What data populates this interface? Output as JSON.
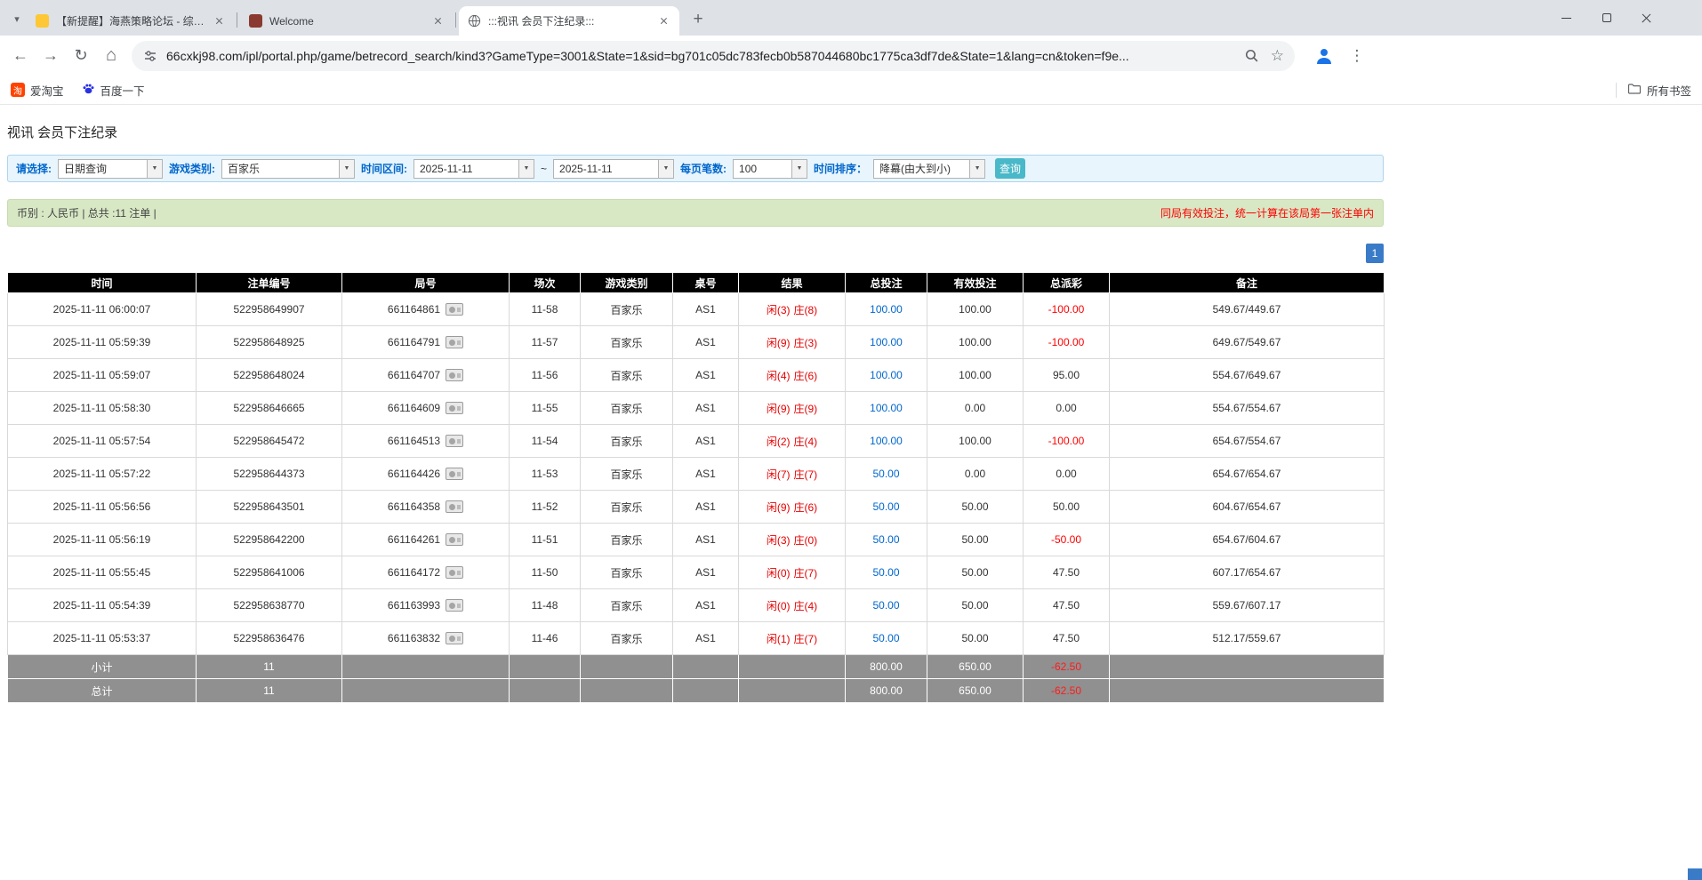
{
  "browser": {
    "tabs": [
      {
        "title": "【新提醒】海燕策略论坛 - 综合..."
      },
      {
        "title": "Welcome"
      },
      {
        "title": ":::视讯 会员下注纪录:::"
      }
    ],
    "url": "66cxkj98.com/ipl/portal.php/game/betrecord_search/kind3?GameType=3001&State=1&sid=bg701c05dc783fecb0b587044680bc1775ca3df7de&State=1&lang=cn&token=f9e...",
    "bookmarks": {
      "taobao": "爱淘宝",
      "taobao_icon_char": "淘",
      "baidu": "百度一下",
      "all_bookmarks": "所有书签"
    }
  },
  "page": {
    "title": "视讯 会员下注纪录",
    "filter": {
      "select_label": "请选择:",
      "select_value": "日期查询",
      "game_label": "游戏类别:",
      "game_value": "百家乐",
      "range_label": "时间区间:",
      "date_from": "2025-11-11",
      "tilde": "~",
      "date_to": "2025-11-11",
      "per_page_label": "每页笔数:",
      "per_page_value": "100",
      "sort_label": "时间排序：",
      "sort_value": "降幕(由大到小)",
      "search_button": "查询"
    },
    "summary_bar": {
      "left": "币别 : 人民币 | 总共 :11 注单 |",
      "right": "同局有效投注，统一计算在该局第一张注单内"
    },
    "pagination": {
      "page": "1"
    },
    "table": {
      "headers": [
        "时间",
        "注单编号",
        "局号",
        "场次",
        "游戏类别",
        "桌号",
        "结果",
        "总投注",
        "有效投注",
        "总派彩",
        "备注"
      ],
      "rows": [
        {
          "time": "2025-11-11 06:00:07",
          "bet_no": "522958649907",
          "round_no": "661164861",
          "session": "11-58",
          "game": "百家乐",
          "table_no": "AS1",
          "result_player": "闲(3)",
          "result_banker": "庄(8)",
          "total_bet": "100.00",
          "valid_bet": "100.00",
          "payout": "-100.00",
          "note": "549.67/449.67"
        },
        {
          "time": "2025-11-11 05:59:39",
          "bet_no": "522958648925",
          "round_no": "661164791",
          "session": "11-57",
          "game": "百家乐",
          "table_no": "AS1",
          "result_player": "闲(9)",
          "result_banker": "庄(3)",
          "total_bet": "100.00",
          "valid_bet": "100.00",
          "payout": "-100.00",
          "note": "649.67/549.67"
        },
        {
          "time": "2025-11-11 05:59:07",
          "bet_no": "522958648024",
          "round_no": "661164707",
          "session": "11-56",
          "game": "百家乐",
          "table_no": "AS1",
          "result_player": "闲(4)",
          "result_banker": "庄(6)",
          "total_bet": "100.00",
          "valid_bet": "100.00",
          "payout": "95.00",
          "note": "554.67/649.67"
        },
        {
          "time": "2025-11-11 05:58:30",
          "bet_no": "522958646665",
          "round_no": "661164609",
          "session": "11-55",
          "game": "百家乐",
          "table_no": "AS1",
          "result_player": "闲(9)",
          "result_banker": "庄(9)",
          "total_bet": "100.00",
          "valid_bet": "0.00",
          "payout": "0.00",
          "note": "554.67/554.67"
        },
        {
          "time": "2025-11-11 05:57:54",
          "bet_no": "522958645472",
          "round_no": "661164513",
          "session": "11-54",
          "game": "百家乐",
          "table_no": "AS1",
          "result_player": "闲(2)",
          "result_banker": "庄(4)",
          "total_bet": "100.00",
          "valid_bet": "100.00",
          "payout": "-100.00",
          "note": "654.67/554.67"
        },
        {
          "time": "2025-11-11 05:57:22",
          "bet_no": "522958644373",
          "round_no": "661164426",
          "session": "11-53",
          "game": "百家乐",
          "table_no": "AS1",
          "result_player": "闲(7)",
          "result_banker": "庄(7)",
          "total_bet": "50.00",
          "valid_bet": "0.00",
          "payout": "0.00",
          "note": "654.67/654.67"
        },
        {
          "time": "2025-11-11 05:56:56",
          "bet_no": "522958643501",
          "round_no": "661164358",
          "session": "11-52",
          "game": "百家乐",
          "table_no": "AS1",
          "result_player": "闲(9)",
          "result_banker": "庄(6)",
          "total_bet": "50.00",
          "valid_bet": "50.00",
          "payout": "50.00",
          "note": "604.67/654.67"
        },
        {
          "time": "2025-11-11 05:56:19",
          "bet_no": "522958642200",
          "round_no": "661164261",
          "session": "11-51",
          "game": "百家乐",
          "table_no": "AS1",
          "result_player": "闲(3)",
          "result_banker": "庄(0)",
          "total_bet": "50.00",
          "valid_bet": "50.00",
          "payout": "-50.00",
          "note": "654.67/604.67"
        },
        {
          "time": "2025-11-11 05:55:45",
          "bet_no": "522958641006",
          "round_no": "661164172",
          "session": "11-50",
          "game": "百家乐",
          "table_no": "AS1",
          "result_player": "闲(0)",
          "result_banker": "庄(7)",
          "total_bet": "50.00",
          "valid_bet": "50.00",
          "payout": "47.50",
          "note": "607.17/654.67"
        },
        {
          "time": "2025-11-11 05:54:39",
          "bet_no": "522958638770",
          "round_no": "661163993",
          "session": "11-48",
          "game": "百家乐",
          "table_no": "AS1",
          "result_player": "闲(0)",
          "result_banker": "庄(4)",
          "total_bet": "50.00",
          "valid_bet": "50.00",
          "payout": "47.50",
          "note": "559.67/607.17"
        },
        {
          "time": "2025-11-11 05:53:37",
          "bet_no": "522958636476",
          "round_no": "661163832",
          "session": "11-46",
          "game": "百家乐",
          "table_no": "AS1",
          "result_player": "闲(1)",
          "result_banker": "庄(7)",
          "total_bet": "50.00",
          "valid_bet": "50.00",
          "payout": "47.50",
          "note": "512.17/559.67"
        }
      ],
      "subtotal": {
        "label": "小计",
        "count": "11",
        "total_bet": "800.00",
        "valid_bet": "650.00",
        "payout": "-62.50"
      },
      "total": {
        "label": "总计",
        "count": "11",
        "total_bet": "800.00",
        "valid_bet": "650.00",
        "payout": "-62.50"
      }
    }
  }
}
